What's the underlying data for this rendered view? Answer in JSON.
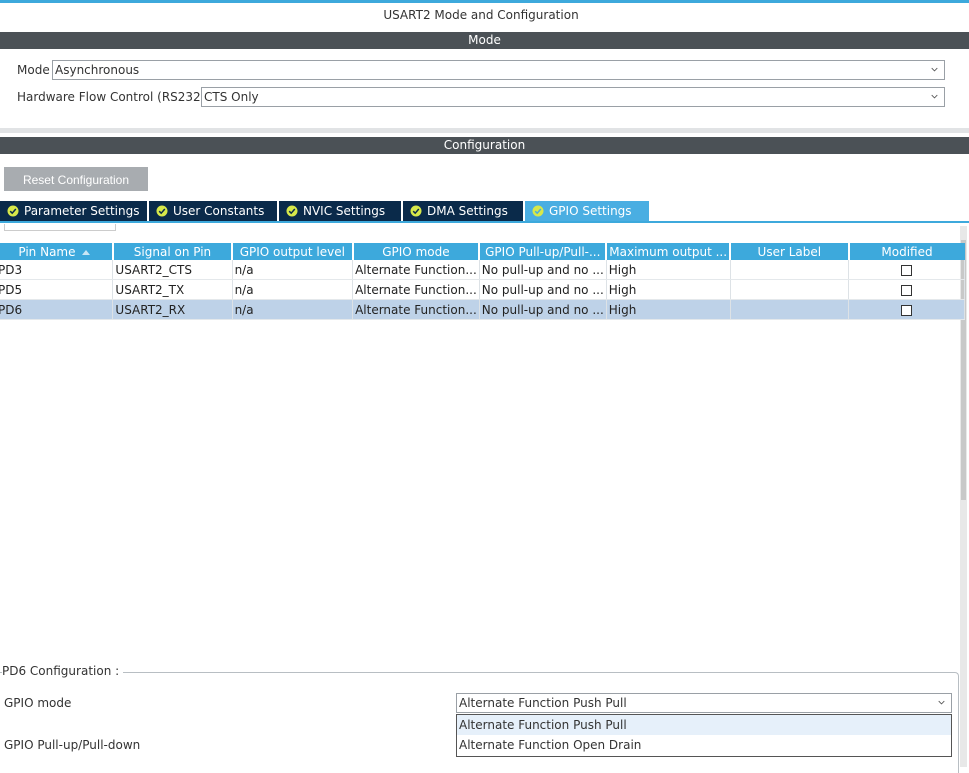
{
  "window": {
    "title": "USART2 Mode and Configuration"
  },
  "mode_section": {
    "header": "Mode",
    "mode_label": "Mode",
    "mode_value": "Asynchronous",
    "flow_label": "Hardware Flow Control (RS232)",
    "flow_value": "CTS Only"
  },
  "config_section": {
    "header": "Configuration",
    "reset_label": "Reset Configuration"
  },
  "tabs": [
    {
      "label": "Parameter Settings",
      "active": false
    },
    {
      "label": "User Constants",
      "active": false
    },
    {
      "label": "NVIC Settings",
      "active": false
    },
    {
      "label": "DMA Settings",
      "active": false
    },
    {
      "label": "GPIO Settings",
      "active": true
    }
  ],
  "table": {
    "columns": [
      "Pin Name",
      "Signal on Pin",
      "GPIO output level",
      "GPIO mode",
      "GPIO Pull-up/Pull-...",
      "Maximum output ...",
      "User Label",
      "Modified"
    ],
    "rows": [
      [
        "PD3",
        "USART2_CTS",
        "n/a",
        "Alternate Function...",
        "No pull-up and no ...",
        "High",
        "",
        false
      ],
      [
        "PD5",
        "USART2_TX",
        "n/a",
        "Alternate Function...",
        "No pull-up and no ...",
        "High",
        "",
        false
      ],
      [
        "PD6",
        "USART2_RX",
        "n/a",
        "Alternate Function...",
        "No pull-up and no ...",
        "High",
        "",
        false
      ]
    ],
    "selected_row": 2
  },
  "pin_config": {
    "legend": "PD6 Configuration :",
    "gpio_mode_label": "GPIO mode",
    "gpio_mode_value": "Alternate Function Push Pull",
    "pull_label": "GPIO Pull-up/Pull-down",
    "dropdown_options": [
      "Alternate Function Push Pull",
      "Alternate Function Open Drain"
    ],
    "highlighted_option": 0
  },
  "colors": {
    "accent": "#3da9dc",
    "tab_inactive": "#0a2a4a",
    "section_bar": "#4b5156",
    "selected_row": "#bed2e8",
    "ok_icon": "#d7e84a"
  }
}
